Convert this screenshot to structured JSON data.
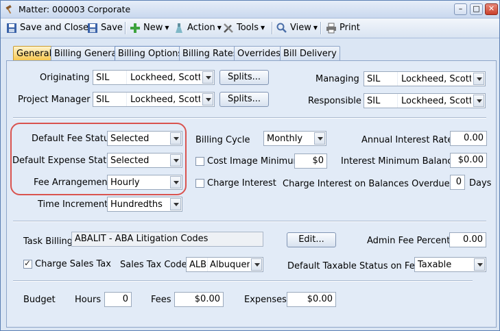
{
  "window": {
    "title": "Matter: 000003 Corporate",
    "controls": {
      "minimize": "–",
      "maximize": "□",
      "close": "✕"
    }
  },
  "toolbar": {
    "save_and_close": "Save and Close",
    "save": "Save",
    "new": "New",
    "action": "Action",
    "tools": "Tools",
    "view": "View",
    "print": "Print"
  },
  "tabs": [
    "General",
    "Billing General",
    "Billing Options",
    "Billing Rates",
    "Overrides",
    "Bill Delivery"
  ],
  "active_tab": "Billing Options",
  "people": {
    "originating": {
      "label": "Originating",
      "code": "SIL",
      "name": "Lockheed, Scott I."
    },
    "project_manager": {
      "label": "Project Manager",
      "code": "SIL",
      "name": "Lockheed, Scott I."
    },
    "managing": {
      "label": "Managing",
      "code": "SIL",
      "name": "Lockheed, Scott I."
    },
    "responsible": {
      "label": "Responsible",
      "code": "SIL",
      "name": "Lockheed, Scott I."
    },
    "splits_label": "Splits..."
  },
  "billing": {
    "default_fee_status": {
      "label": "Default Fee Status",
      "value": "Selected"
    },
    "default_expense_status": {
      "label": "Default Expense Status",
      "value": "Selected"
    },
    "fee_arrangement": {
      "label": "Fee Arrangement",
      "value": "Hourly"
    },
    "time_increments": {
      "label": "Time Increments",
      "value": "Hundredths"
    },
    "billing_cycle": {
      "label": "Billing Cycle",
      "value": "Monthly"
    },
    "cost_image_minimum": {
      "label": "Cost Image Minimum",
      "value": "$0",
      "checked": false
    },
    "charge_interest": {
      "label": "Charge Interest",
      "checked": false
    },
    "annual_interest_rate": {
      "label": "Annual Interest Rate",
      "value": "0.00"
    },
    "interest_minimum_balance": {
      "label": "Interest Minimum Balance",
      "value": "$0.00"
    },
    "charge_interest_overdue": {
      "label": "Charge Interest on Balances Overdue by",
      "value": "0",
      "unit": "Days"
    }
  },
  "task": {
    "task_billing": {
      "label": "Task Billing",
      "value": "ABALIT - ABA Litigation Codes"
    },
    "edit_label": "Edit...",
    "admin_fee_percent": {
      "label": "Admin Fee Percent",
      "value": "0.00"
    },
    "charge_sales_tax": {
      "label": "Charge Sales Tax",
      "checked": true
    },
    "sales_tax_code": {
      "label": "Sales Tax Code",
      "code": "ALB",
      "name": "Albuquerque"
    },
    "default_taxable_status": {
      "label": "Default Taxable Status on Fees",
      "value": "Taxable"
    }
  },
  "budget": {
    "label": "Budget",
    "hours": {
      "label": "Hours",
      "value": "0"
    },
    "fees": {
      "label": "Fees",
      "value": "$0.00"
    },
    "expenses": {
      "label": "Expenses",
      "value": "$0.00"
    }
  },
  "colors": {
    "active_tab": "#f7c548",
    "highlight_ring": "#d9534f",
    "panel": "#e2ebf7"
  }
}
